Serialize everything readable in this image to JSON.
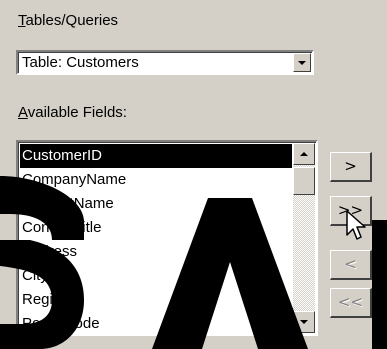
{
  "tables_queries_label": "Tables/Queries",
  "table_select": {
    "value": "Table: Customers"
  },
  "available_fields_label": "Available Fields:",
  "fields": [
    "CustomerID",
    "CompanyName",
    "ContactName",
    "ContactTitle",
    "Address",
    "City",
    "Region",
    "PostalCode"
  ],
  "selected_field_index": 0,
  "buttons": {
    "add_one": ">",
    "add_all": ">>",
    "remove_one": "<",
    "remove_all": "<<"
  },
  "icons": {
    "dropdown": "chevron-down-icon",
    "scroll_up": "scroll-up-icon",
    "scroll_down": "scroll-down-icon",
    "cursor": "mouse-pointer-icon"
  },
  "colors": {
    "panel_bg": "#d4d0c8",
    "selection_bg": "#000000",
    "stamp": "#000000"
  }
}
